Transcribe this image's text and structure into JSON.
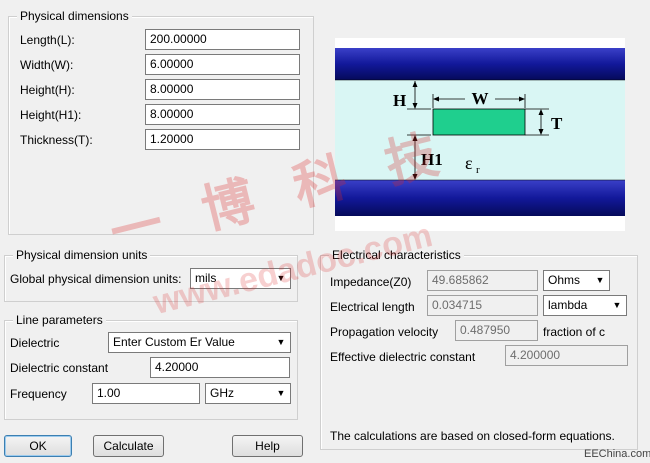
{
  "physical": {
    "title": "Physical dimensions",
    "rows": [
      {
        "label": "Length(L):",
        "value": "200.00000"
      },
      {
        "label": "Width(W):",
        "value": "6.00000"
      },
      {
        "label": "Height(H):",
        "value": "8.00000"
      },
      {
        "label": "Height(H1):",
        "value": "8.00000"
      },
      {
        "label": "Thickness(T):",
        "value": "1.20000"
      }
    ]
  },
  "diagram": {
    "h": "H",
    "w": "W",
    "t": "T",
    "h1": "H1",
    "er": "ε",
    "er_sub": "r",
    "colors": {
      "ground": "#12189a",
      "dielectric": "#d9f6f4",
      "conductor": "#1fcf8e"
    }
  },
  "units": {
    "title": "Physical dimension units",
    "global_label": "Global physical dimension units:",
    "global_value": "mils"
  },
  "line": {
    "title": "Line parameters",
    "dielectric_label": "Dielectric",
    "dielectric_value": "Enter Custom Er Value",
    "constant_label": "Dielectric constant",
    "constant_value": "4.20000",
    "frequency_label": "Frequency",
    "frequency_value": "1.00",
    "frequency_unit": "GHz"
  },
  "electrical": {
    "title": "Electrical characteristics",
    "impedance_label": "Impedance(Z0)",
    "impedance_value": "49.685862",
    "impedance_unit": "Ohms",
    "length_label": "Electrical length",
    "length_value": "0.034715",
    "length_unit": "lambda",
    "velocity_label": "Propagation velocity",
    "velocity_value": "0.487950",
    "velocity_unit": "fraction of c",
    "eff_label": "Effective dielectric constant",
    "eff_value": "4.200000",
    "note": "The calculations are based on closed-form equations."
  },
  "buttons": {
    "ok": "OK",
    "calculate": "Calculate",
    "help": "Help"
  },
  "watermark": {
    "cn": "一 博 科 技",
    "url": "www.edadoc.com",
    "footer": "EEChina.com"
  }
}
